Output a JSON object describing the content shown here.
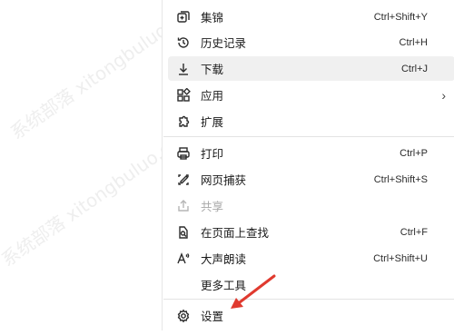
{
  "menu": {
    "items": [
      {
        "label": "集锦",
        "shortcut": "Ctrl+Shift+Y",
        "icon": "collections-icon"
      },
      {
        "label": "历史记录",
        "shortcut": "Ctrl+H",
        "icon": "history-icon"
      },
      {
        "label": "下载",
        "shortcut": "Ctrl+J",
        "icon": "download-icon"
      },
      {
        "label": "应用",
        "shortcut": "",
        "icon": "apps-icon",
        "chevron": "›"
      },
      {
        "label": "扩展",
        "shortcut": "",
        "icon": "extensions-icon"
      },
      {
        "label": "打印",
        "shortcut": "Ctrl+P",
        "icon": "print-icon"
      },
      {
        "label": "网页捕获",
        "shortcut": "Ctrl+Shift+S",
        "icon": "web-capture-icon"
      },
      {
        "label": "共享",
        "shortcut": "",
        "icon": "share-icon"
      },
      {
        "label": "在页面上查找",
        "shortcut": "Ctrl+F",
        "icon": "find-icon"
      },
      {
        "label": "大声朗读",
        "shortcut": "Ctrl+Shift+U",
        "icon": "read-aloud-icon"
      },
      {
        "label": "更多工具",
        "shortcut": "",
        "icon": ""
      },
      {
        "label": "设置",
        "shortcut": "",
        "icon": "gear-icon"
      }
    ]
  },
  "colors": {
    "hover_bg": "#f0f0f0",
    "arrow": "#e03a2f",
    "disabled_text": "#a9a9a9"
  }
}
